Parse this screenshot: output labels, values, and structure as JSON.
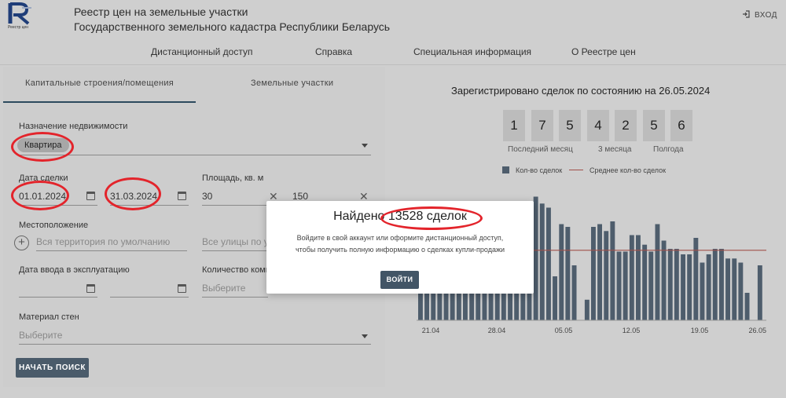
{
  "header": {
    "logo_caption": "Реестр цен",
    "title_line1": "Реестр цен на земельные участки",
    "title_line2": "Государственного земельного кадастра Республики Беларусь",
    "login_label": "ВХОД"
  },
  "nav": [
    "Дистанционный доступ",
    "Справка",
    "Специальная информация",
    "О Реестре цен"
  ],
  "tabs": [
    "Капитальные строения/помещения",
    "Земельные участки"
  ],
  "form": {
    "purpose_label": "Назначение недвижимости",
    "purpose_chip": "Квартира",
    "deal_date_label": "Дата сделки",
    "date_from": "01.01.2024",
    "date_to": "31.03.2024",
    "area_label": "Площадь, кв. м",
    "area_from": "30",
    "area_to": "150",
    "location_label": "Местоположение",
    "territory_placeholder": "Вся территория по умолчанию",
    "streets_placeholder": "Все улицы по ум",
    "commission_date_label": "Дата ввода в эксплуатацию",
    "rooms_label": "Количество комна",
    "rooms_placeholder": "Выберите",
    "walls_label": "Материал стен",
    "walls_placeholder": "Выберите",
    "search_button": "НАЧАТЬ ПОИСК"
  },
  "stats": {
    "title": "Зарегистрировано сделок по состоянию на 26.05.2024",
    "digits": [
      "1",
      "7",
      "5",
      "4",
      "2",
      "5",
      "6"
    ],
    "periods": [
      "Последний месяц",
      "3 месяца",
      "Полгода"
    ],
    "legend_bar": "Кол-во сделок",
    "legend_line": "Среднее кол-во сделок"
  },
  "chart_data": {
    "type": "bar",
    "x_tick_labels": [
      "21.04",
      "28.04",
      "05.05",
      "12.05",
      "19.05",
      "26.05"
    ],
    "values": [
      70,
      55,
      78,
      83,
      60,
      55,
      52,
      73,
      82,
      45,
      50,
      48,
      40,
      62,
      35,
      68,
      58,
      52,
      90,
      85,
      82,
      32,
      70,
      68,
      40,
      0,
      15,
      68,
      70,
      65,
      72,
      50,
      50,
      62,
      62,
      55,
      50,
      70,
      58,
      52,
      52,
      48,
      48,
      60,
      42,
      48,
      52,
      52,
      45,
      45,
      42,
      20,
      0,
      40
    ],
    "average": 51,
    "colors": {
      "bar": "#4e5d6c",
      "average_line": "#a0504a"
    }
  },
  "modal": {
    "title": "Найдено 13528 сделок",
    "line1": "Войдите в свой аккаунт или оформите дистанционный доступ,",
    "line2": "чтобы получить полную информацию о сделках купли-продажи",
    "button": "ВОЙТИ"
  }
}
